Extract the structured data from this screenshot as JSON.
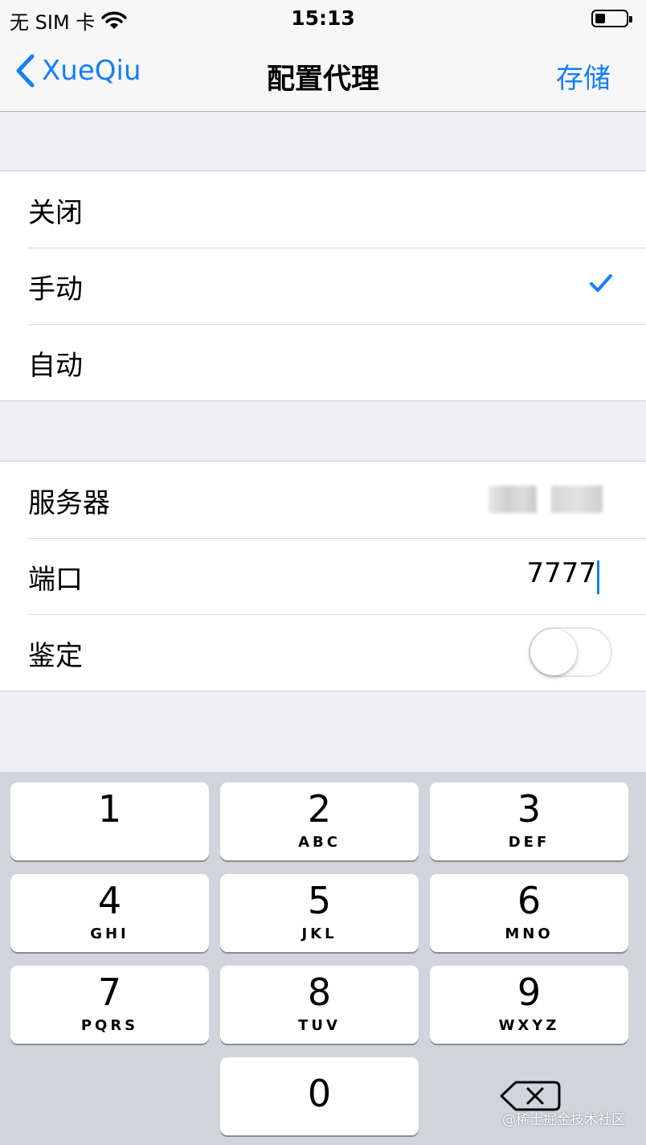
{
  "status_bar": {
    "carrier": "无 SIM 卡",
    "time": "15:13"
  },
  "nav": {
    "back_label": "XueQiu",
    "title": "配置代理",
    "save_label": "存储"
  },
  "mode_options": [
    {
      "label": "关闭",
      "selected": false
    },
    {
      "label": "手动",
      "selected": true
    },
    {
      "label": "自动",
      "selected": false
    }
  ],
  "settings": {
    "server_label": "服务器",
    "port_label": "端口",
    "port_value": "7777",
    "auth_label": "鉴定",
    "auth_enabled": false
  },
  "keypad": [
    {
      "digit": "1",
      "letters": ""
    },
    {
      "digit": "2",
      "letters": "ABC"
    },
    {
      "digit": "3",
      "letters": "DEF"
    },
    {
      "digit": "4",
      "letters": "GHI"
    },
    {
      "digit": "5",
      "letters": "JKL"
    },
    {
      "digit": "6",
      "letters": "MNO"
    },
    {
      "digit": "7",
      "letters": "PQRS"
    },
    {
      "digit": "8",
      "letters": "TUV"
    },
    {
      "digit": "9",
      "letters": "WXYZ"
    },
    {
      "digit": "0",
      "letters": ""
    }
  ],
  "watermark": "@稀土掘金技术社区",
  "colors": {
    "accent": "#147efb",
    "background": "#efeff4",
    "keyboard": "#d1d4db"
  }
}
